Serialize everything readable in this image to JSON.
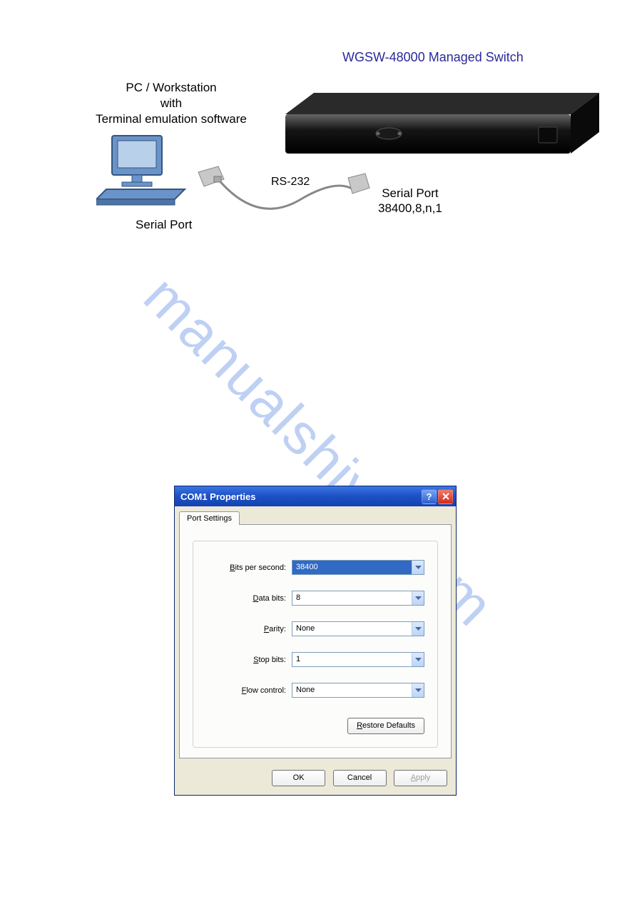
{
  "watermark": "manualshive.com",
  "diagram": {
    "switch_title": "WGSW-48000  Managed Switch",
    "pc_line1": "PC / Workstation",
    "pc_line2": "with",
    "pc_line3": "Terminal emulation software",
    "cable_label": "RS-232",
    "serial_left": "Serial Port",
    "serial_right_line1": "Serial Port",
    "serial_right_line2": "38400,8,n,1"
  },
  "dialog": {
    "title": "COM1 Properties",
    "tab": "Port Settings",
    "fields": {
      "bits_per_second": {
        "label_pre": "B",
        "label_rest": "its per second:",
        "value": "38400"
      },
      "data_bits": {
        "label_pre": "D",
        "label_rest": "ata bits:",
        "value": "8"
      },
      "parity": {
        "label_pre": "P",
        "label_rest": "arity:",
        "value": "None"
      },
      "stop_bits": {
        "label_pre": "S",
        "label_rest": "top bits:",
        "value": "1"
      },
      "flow_control": {
        "label_pre": "F",
        "label_rest": "low control:",
        "value": "None"
      }
    },
    "restore_pre": "R",
    "restore_rest": "estore Defaults",
    "ok": "OK",
    "cancel": "Cancel",
    "apply_pre": "A",
    "apply_rest": "pply"
  }
}
